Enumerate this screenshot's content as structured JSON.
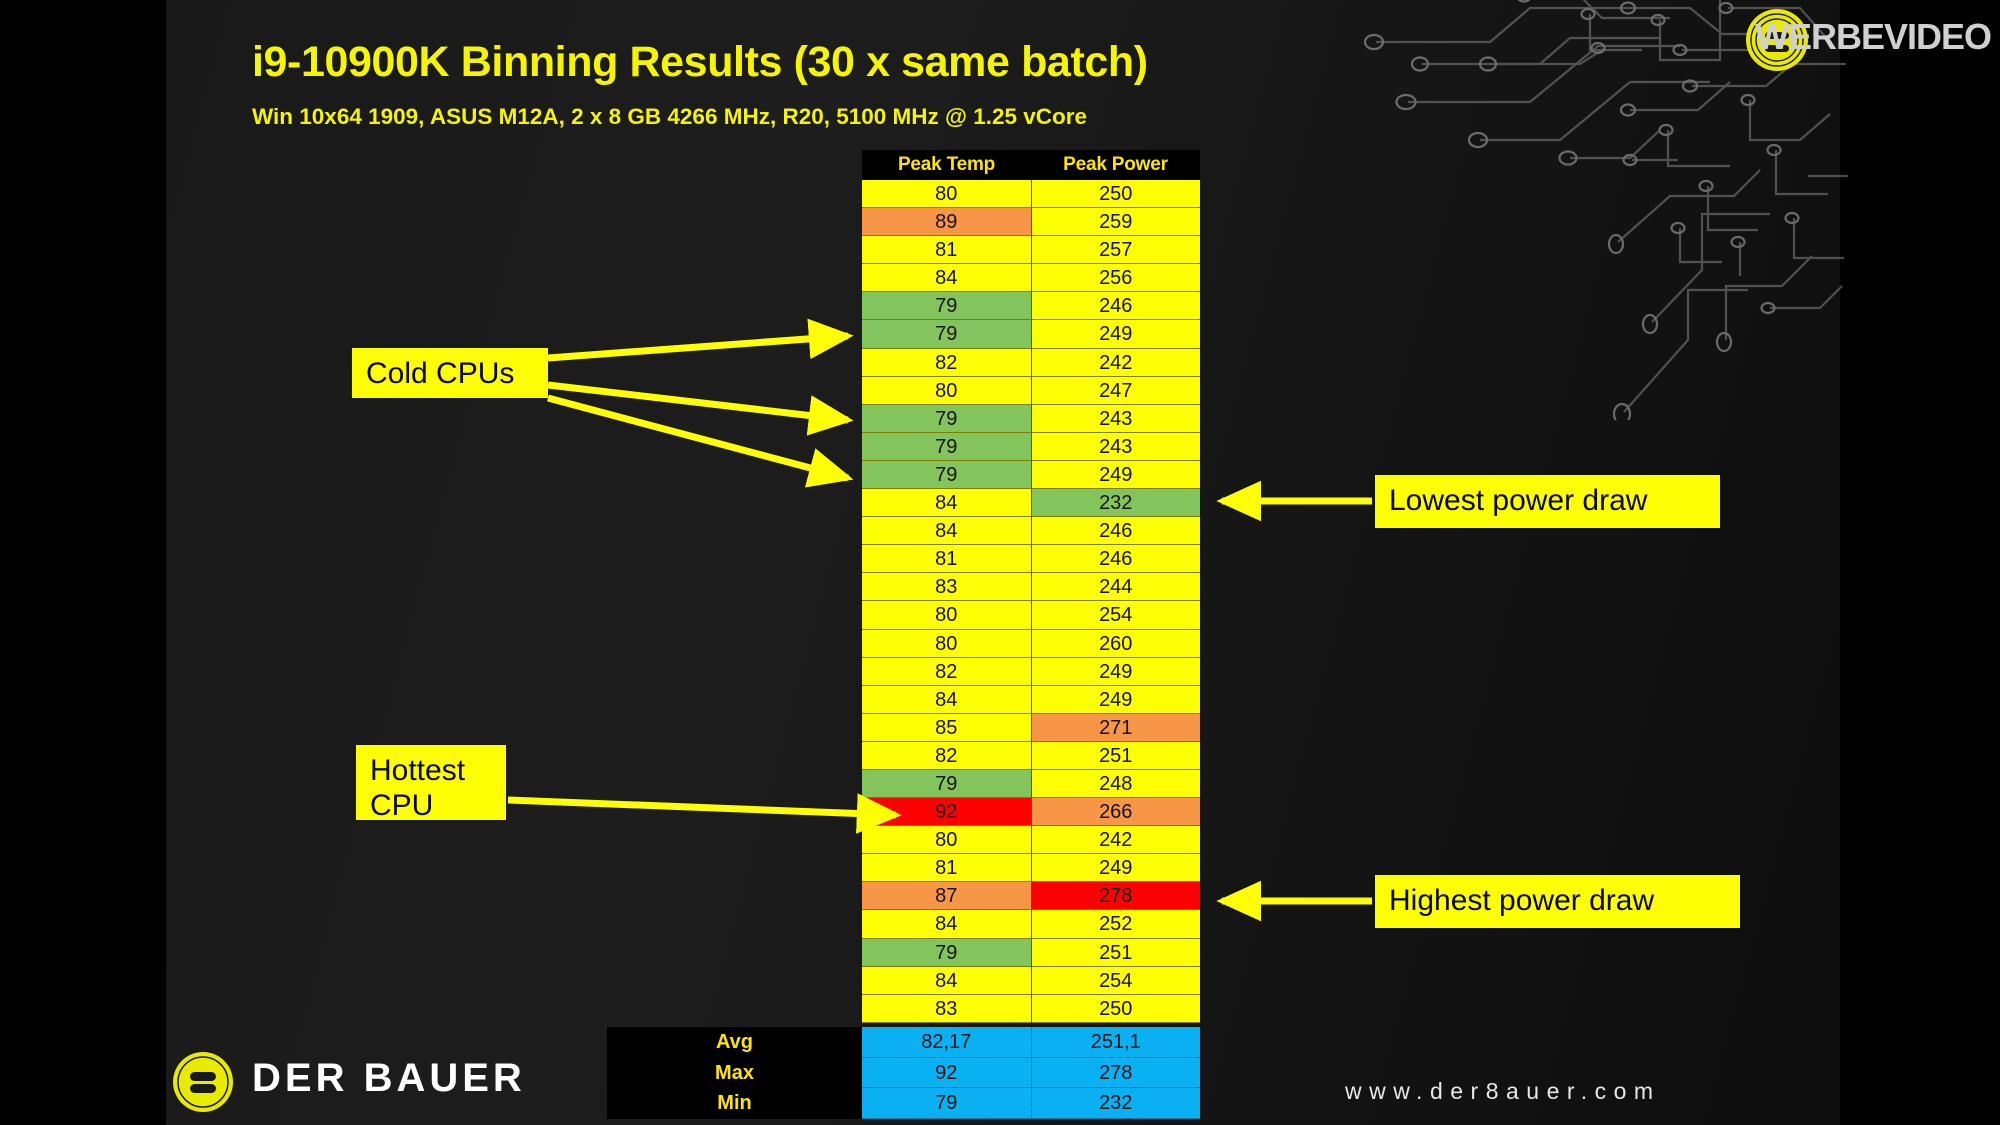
{
  "header": {
    "title": "i9-10900K Binning Results (30 x same batch)",
    "subtitle": "Win 10x64 1909, ASUS M12A, 2 x 8 GB 4266 MHz, R20, 5100 MHz @ 1.25 vCore"
  },
  "branding": {
    "top_right_logo_text": "WERBEVIDEO",
    "bottom_left_logo_text": "DER BAUER",
    "website": "www.der8auer.com"
  },
  "callouts": {
    "cold_cpus": "Cold CPUs",
    "hottest_cpu": "Hottest\nCPU",
    "hottest_cpu_line1": "Hottest",
    "hottest_cpu_line2": "CPU",
    "lowest_power": "Lowest power draw",
    "highest_power": "Highest power draw"
  },
  "colors": {
    "accent_yellow": "#f5f500",
    "cell_yellow": "#fdfd04",
    "cell_green": "#84c45c",
    "cell_orange": "#f79646",
    "cell_red": "#fe0000",
    "cell_blue": "#09b0f2",
    "background": "#1a1a1a"
  },
  "chart_data": {
    "type": "table",
    "title": "i9-10900K Binning Results (30 x same batch)",
    "subtitle": "Win 10x64 1909, ASUS M12A, 2 x 8 GB 4266 MHz, R20, 5100 MHz @ 1.25 vCore",
    "columns": [
      "Peak Temp",
      "Peak Power"
    ],
    "row_count": 30,
    "rows": [
      {
        "temp": "80",
        "temp_color": "yellow",
        "power": "250",
        "power_color": "yellow"
      },
      {
        "temp": "89",
        "temp_color": "orange",
        "power": "259",
        "power_color": "yellow"
      },
      {
        "temp": "81",
        "temp_color": "yellow",
        "power": "257",
        "power_color": "yellow"
      },
      {
        "temp": "84",
        "temp_color": "yellow",
        "power": "256",
        "power_color": "yellow"
      },
      {
        "temp": "79",
        "temp_color": "green",
        "power": "246",
        "power_color": "yellow"
      },
      {
        "temp": "79",
        "temp_color": "green",
        "power": "249",
        "power_color": "yellow"
      },
      {
        "temp": "82",
        "temp_color": "yellow",
        "power": "242",
        "power_color": "yellow"
      },
      {
        "temp": "80",
        "temp_color": "yellow",
        "power": "247",
        "power_color": "yellow"
      },
      {
        "temp": "79",
        "temp_color": "green",
        "power": "243",
        "power_color": "yellow"
      },
      {
        "temp": "79",
        "temp_color": "green",
        "power": "243",
        "power_color": "yellow"
      },
      {
        "temp": "79",
        "temp_color": "green",
        "power": "249",
        "power_color": "yellow"
      },
      {
        "temp": "84",
        "temp_color": "yellow",
        "power": "232",
        "power_color": "green"
      },
      {
        "temp": "84",
        "temp_color": "yellow",
        "power": "246",
        "power_color": "yellow"
      },
      {
        "temp": "81",
        "temp_color": "yellow",
        "power": "246",
        "power_color": "yellow"
      },
      {
        "temp": "83",
        "temp_color": "yellow",
        "power": "244",
        "power_color": "yellow"
      },
      {
        "temp": "80",
        "temp_color": "yellow",
        "power": "254",
        "power_color": "yellow"
      },
      {
        "temp": "80",
        "temp_color": "yellow",
        "power": "260",
        "power_color": "yellow"
      },
      {
        "temp": "82",
        "temp_color": "yellow",
        "power": "249",
        "power_color": "yellow"
      },
      {
        "temp": "84",
        "temp_color": "yellow",
        "power": "249",
        "power_color": "yellow"
      },
      {
        "temp": "85",
        "temp_color": "yellow",
        "power": "271",
        "power_color": "orange"
      },
      {
        "temp": "82",
        "temp_color": "yellow",
        "power": "251",
        "power_color": "yellow"
      },
      {
        "temp": "79",
        "temp_color": "green",
        "power": "248",
        "power_color": "yellow"
      },
      {
        "temp": "92",
        "temp_color": "red",
        "power": "266",
        "power_color": "orange"
      },
      {
        "temp": "80",
        "temp_color": "yellow",
        "power": "242",
        "power_color": "yellow"
      },
      {
        "temp": "81",
        "temp_color": "yellow",
        "power": "249",
        "power_color": "yellow"
      },
      {
        "temp": "87",
        "temp_color": "orange",
        "power": "278",
        "power_color": "red"
      },
      {
        "temp": "84",
        "temp_color": "yellow",
        "power": "252",
        "power_color": "yellow"
      },
      {
        "temp": "79",
        "temp_color": "green",
        "power": "251",
        "power_color": "yellow"
      },
      {
        "temp": "84",
        "temp_color": "yellow",
        "power": "254",
        "power_color": "yellow"
      },
      {
        "temp": "83",
        "temp_color": "yellow",
        "power": "250",
        "power_color": "yellow"
      }
    ],
    "summary": [
      {
        "label": "Avg",
        "temp": "82,17",
        "power": "251,1"
      },
      {
        "label": "Max",
        "temp": "92",
        "power": "278"
      },
      {
        "label": "Min",
        "temp": "79",
        "power": "232"
      }
    ]
  }
}
